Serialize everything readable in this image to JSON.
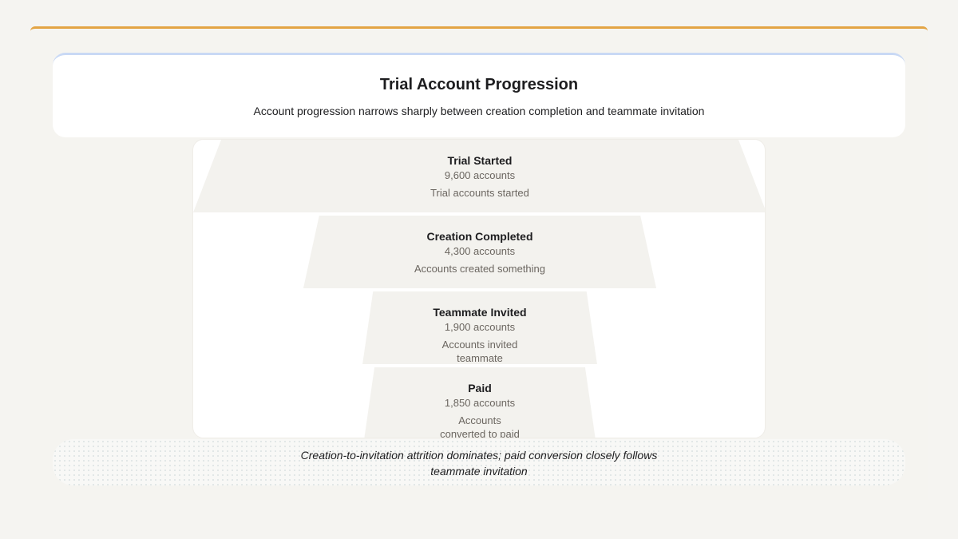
{
  "header": {
    "title": "Trial Account Progression",
    "subtitle": "Account progression narrows sharply between creation completion and teammate invitation"
  },
  "chart_data": {
    "type": "funnel",
    "title": "Trial Account Progression",
    "subtitle": "Account progression narrows sharply between creation completion and teammate invitation",
    "stages": [
      {
        "name": "Trial Started",
        "value": 9600,
        "value_label": "9,600 accounts",
        "description": "Trial accounts started"
      },
      {
        "name": "Creation Completed",
        "value": 4300,
        "value_label": "4,300 accounts",
        "description": "Accounts created something"
      },
      {
        "name": "Teammate Invited",
        "value": 1900,
        "value_label": "1,900 accounts",
        "description": "Accounts invited teammate"
      },
      {
        "name": "Paid",
        "value": 1850,
        "value_label": "1,850 accounts",
        "description": "Accounts converted to paid"
      }
    ],
    "colors": {
      "segment": "#f3f2ee",
      "card": "#ffffff",
      "accent": "#e3a444"
    }
  },
  "footer": {
    "note": "Creation-to-invitation attrition dominates; paid conversion closely follows teammate invitation"
  }
}
